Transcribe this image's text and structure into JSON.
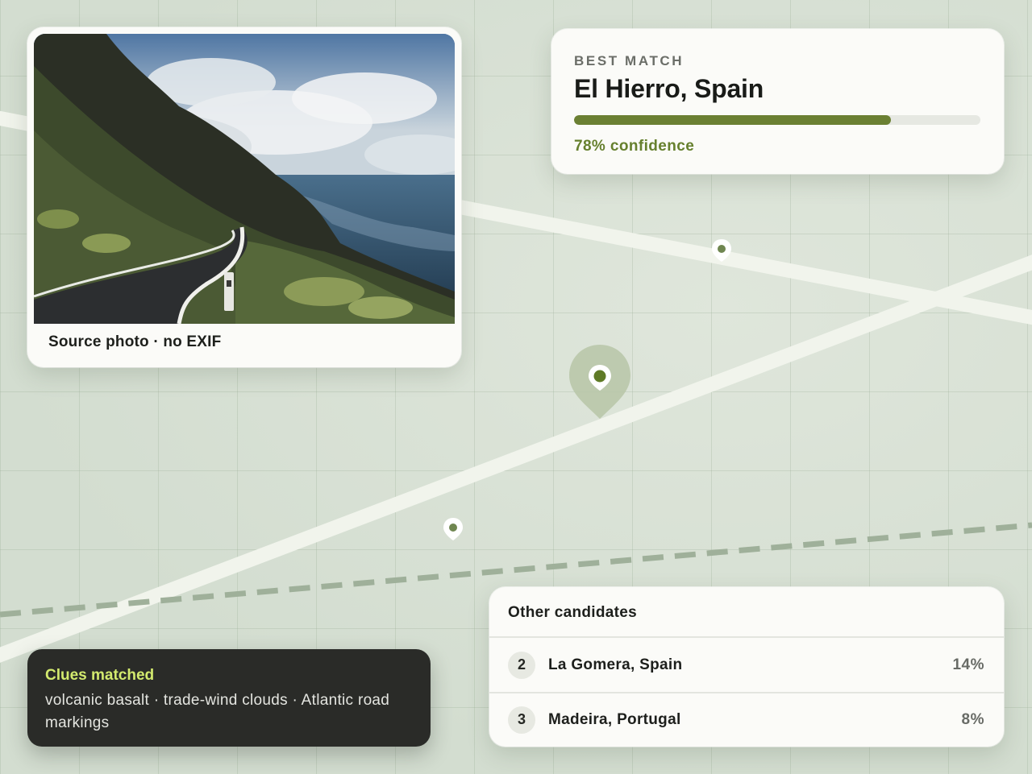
{
  "source_photo": {
    "caption": "Source photo · no EXIF"
  },
  "best_match": {
    "eyebrow": "BEST MATCH",
    "location": "El Hierro, Spain",
    "confidence_value": 0.78,
    "confidence_label": "78% confidence"
  },
  "clues": {
    "title": "Clues matched",
    "text": "volcanic basalt · trade-wind clouds · Atlantic road markings"
  },
  "candidates": {
    "header": "Other candidates",
    "items": [
      {
        "rank": "2",
        "name": "La Gomera, Spain",
        "percent": "14%"
      },
      {
        "rank": "3",
        "name": "Madeira, Portugal",
        "percent": "8%"
      }
    ]
  },
  "map": {
    "pins": [
      "primary-location-pin-icon",
      "location-pin-icon",
      "location-pin-icon"
    ]
  },
  "colors": {
    "accent": "#6b8033",
    "confidence_text": "#66802e",
    "clues_title": "#d3ea6e",
    "clues_bg": "#2a2b28",
    "map_bg": "#d6dfd3"
  }
}
